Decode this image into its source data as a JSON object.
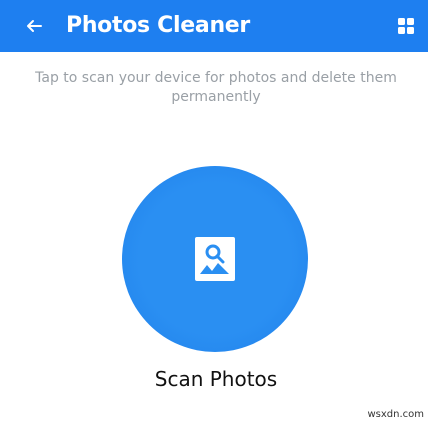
{
  "appbar": {
    "title": "Photos Cleaner",
    "back_icon": "arrow-left-icon",
    "menu_icon": "grid-icon",
    "color": "#1e7ff0"
  },
  "main": {
    "instruction": "Tap to scan your device for photos and delete them permanently",
    "scan_icon": "photo-search-icon",
    "scan_label": "Scan Photos",
    "scan_color": "#2a8ff2"
  },
  "watermark": "wsxdn.com"
}
